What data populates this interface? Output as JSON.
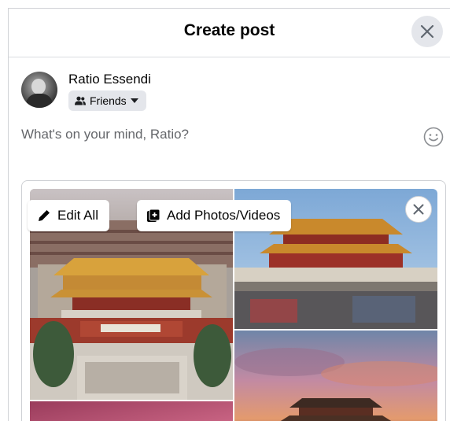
{
  "dialog": {
    "title": "Create post",
    "close_icon": "close-icon"
  },
  "author": {
    "name": "Ratio Essendi",
    "audience": "Friends",
    "audience_icon": "friends-icon",
    "audience_caret_icon": "caret-down-icon"
  },
  "composer": {
    "placeholder": "What's on your mind, Ratio?",
    "emoji_icon": "emoji-icon"
  },
  "media": {
    "edit_all_label": "Edit All",
    "edit_icon": "pencil-icon",
    "add_label": "Add Photos/Videos",
    "add_icon": "add-photo-icon",
    "remove_icon": "close-icon",
    "photos": [
      "forbidden-city-aerial",
      "forbidden-city-hall-crowd",
      "forbidden-city-sunset",
      "pink-sky-photo"
    ]
  },
  "colors": {
    "button_gray": "#e4e6eb",
    "placeholder_text": "#65676b",
    "border": "#ced0d4"
  }
}
